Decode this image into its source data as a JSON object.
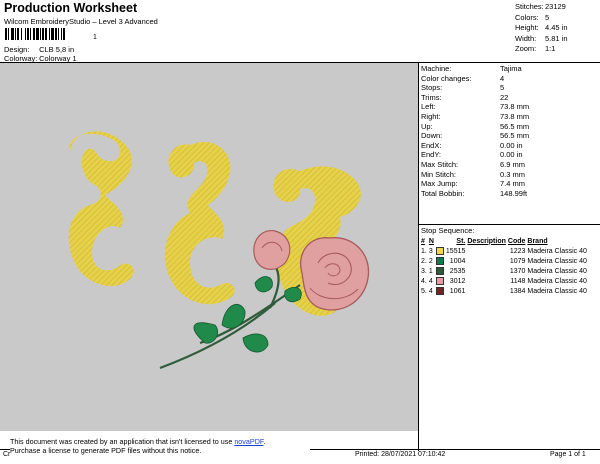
{
  "header": {
    "title": "Production Worksheet",
    "subtitle": "Wilcom EmbroideryStudio – Level 3 Advanced",
    "barcode_number": "1",
    "design_label": "Design:",
    "design_value": "CLB 5,8 in",
    "colorway_label": "Colorway:",
    "colorway_value": "Colorway 1"
  },
  "stats": [
    {
      "label": "Stitches:",
      "value": "23129"
    },
    {
      "label": "Colors:",
      "value": "5"
    },
    {
      "label": "Height:",
      "value": "4.45 in"
    },
    {
      "label": "Width:",
      "value": "5.81 in"
    },
    {
      "label": "Zoom:",
      "value": "1:1"
    }
  ],
  "machine_info": [
    {
      "label": "Machine:",
      "value": "Tajima"
    },
    {
      "label": "Color changes:",
      "value": "4"
    },
    {
      "label": "Stops:",
      "value": "5"
    },
    {
      "label": "Trims:",
      "value": "22"
    },
    {
      "label": "Left:",
      "value": "73.8 mm"
    },
    {
      "label": "Right:",
      "value": "73.8 mm"
    },
    {
      "label": "Up:",
      "value": "56.5 mm"
    },
    {
      "label": "Down:",
      "value": "56.5 mm"
    },
    {
      "label": "EndX:",
      "value": "0.00 in"
    },
    {
      "label": "EndY:",
      "value": "0.00 in"
    },
    {
      "label": "Max Stitch:",
      "value": "6.9 mm"
    },
    {
      "label": "Min Stitch:",
      "value": "0.3 mm"
    },
    {
      "label": "Max Jump:",
      "value": "7.4 mm"
    },
    {
      "label": "Total Bobbin:",
      "value": "148.99ft"
    }
  ],
  "stop_sequence": {
    "title": "Stop Sequence:",
    "headers": {
      "num": "#",
      "n": "N",
      "st": "St.",
      "description": "Description",
      "code": "Code",
      "brand": "Brand"
    },
    "rows": [
      {
        "num": "1.",
        "n": "3",
        "color": "#f0d64a",
        "st": "15515",
        "description": "",
        "code": "1223",
        "brand": "Madeira Classic 40"
      },
      {
        "num": "2.",
        "n": "2",
        "color": "#0f7a4a",
        "st": "1004",
        "description": "",
        "code": "1079",
        "brand": "Madeira Classic 40"
      },
      {
        "num": "3.",
        "n": "1",
        "color": "#2c5a3a",
        "st": "2535",
        "description": "",
        "code": "1370",
        "brand": "Madeira Classic 40"
      },
      {
        "num": "4.",
        "n": "4",
        "color": "#e89aa6",
        "st": "3012",
        "description": "",
        "code": "1148",
        "brand": "Madeira Classic 40"
      },
      {
        "num": "5.",
        "n": "4",
        "color": "#6e2626",
        "st": "1061",
        "description": "",
        "code": "1384",
        "brand": "Madeira Classic 40"
      }
    ]
  },
  "footer": {
    "note_line1": "This document was created by an application that isn't licensed to use ",
    "note_link": "novaPDF",
    "note_line1_end": ".",
    "note_line2": "Purchase a license to generate PDF files without this notice.",
    "cr": "Cr",
    "printed": "Printed: 28/07/2021 07:10:42",
    "page": "Page 1 of 1"
  },
  "design_colors": {
    "canvas_bg": "#c9c9c9",
    "letter_yellow": "#e6d14a",
    "letter_dark": "#cdb52e",
    "rose_pink": "#e0a0a0",
    "rose_dark": "#a85a5a",
    "leaf_green": "#1f8a4a",
    "stem_green": "#2f5c3a"
  }
}
